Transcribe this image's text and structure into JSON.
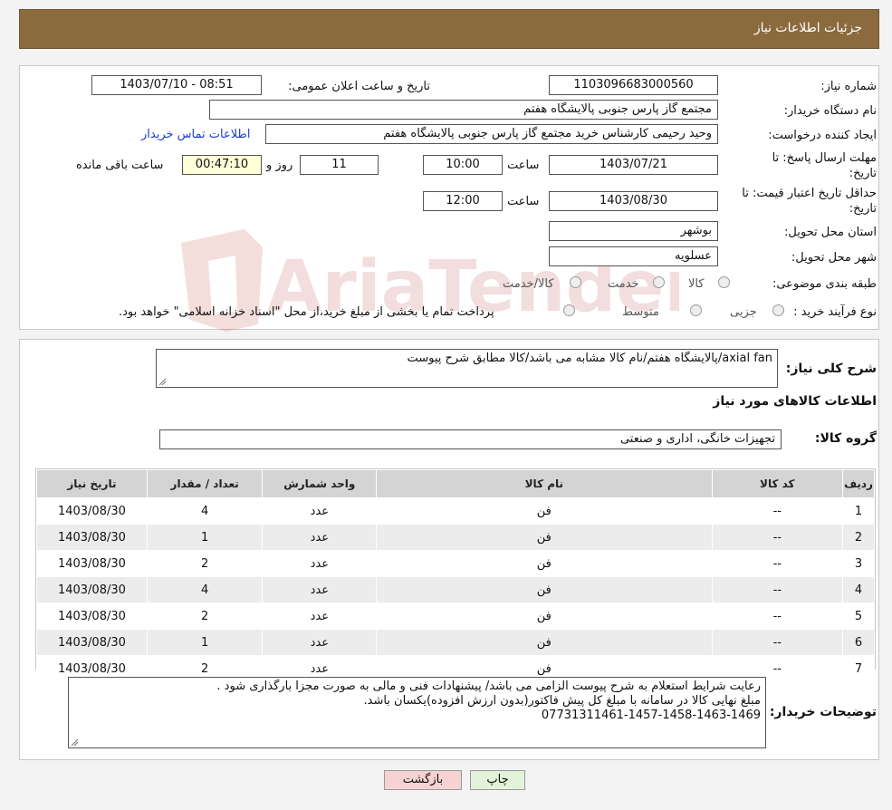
{
  "header": {
    "title": "جزئیات اطلاعات نیاز"
  },
  "info": {
    "need_number_label": "شماره نیاز:",
    "need_number": "1103096683000560",
    "announce_label": "تاریخ و ساعت اعلان عمومی:",
    "announce_value": "1403/07/10 - 08:51",
    "buyer_org_label": "نام دستگاه خریدار:",
    "buyer_org": "مجتمع گاز پارس جنوبی  پالایشگاه هفتم",
    "creator_label": "ایجاد کننده درخواست:",
    "creator": "وحید رحیمی کارشناس خرید مجتمع گاز پارس جنوبی  پالایشگاه هفتم",
    "contact_link": "اطلاعات تماس خریدار",
    "deadline_label_1": "مهلت ارسال پاسخ: تا",
    "deadline_label_2": "تاریخ:",
    "deadline_date": "1403/07/21",
    "time_label": "ساعت",
    "deadline_time": "10:00",
    "days": "11",
    "days_label": "روز و",
    "remaining": "00:47:10",
    "remaining_label": "ساعت باقی مانده",
    "validity_label_1": "حداقل تاریخ اعتبار قیمت: تا",
    "validity_label_2": "تاریخ:",
    "validity_date": "1403/08/30",
    "validity_time": "12:00",
    "province_label": "استان محل تحویل:",
    "province": "بوشهر",
    "city_label": "شهر محل تحویل:",
    "city": "عسلویه",
    "category_label": "طبقه بندی موضوعی:",
    "category_options": [
      "کالا",
      "خدمت",
      "کالا/خدمت"
    ],
    "process_label": "نوع فرآیند خرید :",
    "process_options": [
      "جزیی",
      "متوسط"
    ],
    "process_note": "پرداخت تمام یا بخشی از مبلغ خرید،از محل \"اسناد خزانه اسلامی\" خواهد بود."
  },
  "description": {
    "label": "شرح کلی نیاز:",
    "text": "axial fan/پالایشگاه هفتم/نام کالا مشابه می باشد/کالا مطابق شرح پیوست"
  },
  "goods": {
    "section_title": "اطلاعات کالاهای مورد نیاز",
    "group_label": "گروه کالا:",
    "group_value": "تجهیزات خانگی، اداری و صنعتی",
    "columns": [
      "ردیف",
      "کد کالا",
      "نام کالا",
      "واحد شمارش",
      "تعداد / مقدار",
      "تاریخ نیاز"
    ],
    "rows": [
      {
        "row": "1",
        "code": "--",
        "name": "فن",
        "unit": "عدد",
        "qty": "4",
        "date": "1403/08/30"
      },
      {
        "row": "2",
        "code": "--",
        "name": "فن",
        "unit": "عدد",
        "qty": "1",
        "date": "1403/08/30"
      },
      {
        "row": "3",
        "code": "--",
        "name": "فن",
        "unit": "عدد",
        "qty": "2",
        "date": "1403/08/30"
      },
      {
        "row": "4",
        "code": "--",
        "name": "فن",
        "unit": "عدد",
        "qty": "4",
        "date": "1403/08/30"
      },
      {
        "row": "5",
        "code": "--",
        "name": "فن",
        "unit": "عدد",
        "qty": "2",
        "date": "1403/08/30"
      },
      {
        "row": "6",
        "code": "--",
        "name": "فن",
        "unit": "عدد",
        "qty": "1",
        "date": "1403/08/30"
      },
      {
        "row": "7",
        "code": "--",
        "name": "فن",
        "unit": "عدد",
        "qty": "2",
        "date": "1403/08/30"
      }
    ]
  },
  "buyer_notes": {
    "label": "توضیحات خریدار:",
    "lines": [
      "رعایت شرایط استعلام به شرح پیوست الزامی می باشد/ پیشنهادات فنی و مالی به صورت مجزا بارگذاری شود .",
      "مبلغ نهایی کالا در سامانه با مبلغ کل پیش فاکتور(بدون ارزش افزوده)یکسان باشد.",
      "07731311461-1457-1458-1463-1469"
    ]
  },
  "buttons": {
    "print": "چاپ",
    "back": "بازگشت"
  },
  "watermark": {
    "text": "AriaTender.neT"
  },
  "colors": {
    "header": "#8b6b3e",
    "link": "#1a3ecf",
    "back_button": "#f6d2d2",
    "print_button": "#e3f3d9"
  }
}
